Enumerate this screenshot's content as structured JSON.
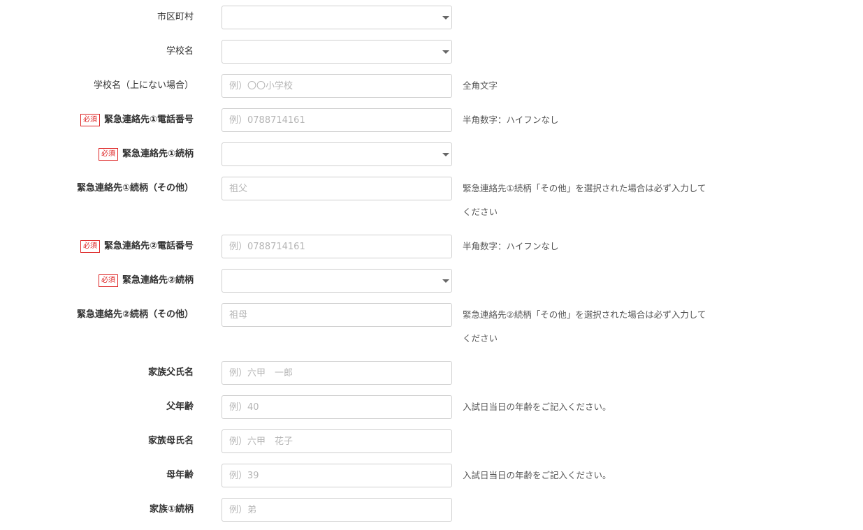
{
  "rows": [
    {
      "label": "市区町村",
      "type": "select"
    },
    {
      "label": "学校名",
      "type": "select"
    },
    {
      "label": "学校名（上にない場合）",
      "type": "input",
      "placeholder": "例）〇〇小学校",
      "note": "全角文字"
    },
    {
      "label": "緊急連絡先①電話番号",
      "required": "必須",
      "type": "input",
      "placeholder": "例）0788714161",
      "note": "半角数字：ハイフンなし"
    },
    {
      "label": "緊急連絡先①続柄",
      "required": "必須",
      "type": "select"
    },
    {
      "label": "緊急連絡先①続柄（その他）",
      "type": "input",
      "placeholder": "祖父",
      "note": "緊急連絡先①続柄「その他」を選択された場合は必ず入力してください"
    },
    {
      "label": "緊急連絡先②電話番号",
      "required": "必須",
      "type": "input",
      "placeholder": "例）0788714161",
      "note": "半角数字：ハイフンなし"
    },
    {
      "label": "緊急連絡先②続柄",
      "required": "必須",
      "type": "select"
    },
    {
      "label": "緊急連絡先②続柄（その他）",
      "type": "input",
      "placeholder": "祖母",
      "note": "緊急連絡先②続柄「その他」を選択された場合は必ず入力してください"
    },
    {
      "label": "家族父氏名",
      "type": "input",
      "placeholder": "例）六甲　一郎"
    },
    {
      "label": "父年齢",
      "type": "input",
      "placeholder": "例）40",
      "note": "入試日当日の年齢をご記入ください。"
    },
    {
      "label": "家族母氏名",
      "type": "input",
      "placeholder": "例）六甲　花子"
    },
    {
      "label": "母年齢",
      "type": "input",
      "placeholder": "例）39",
      "note": "入試日当日の年齢をご記入ください。"
    },
    {
      "label": "家族①続柄",
      "type": "input",
      "placeholder": "例）弟"
    }
  ]
}
